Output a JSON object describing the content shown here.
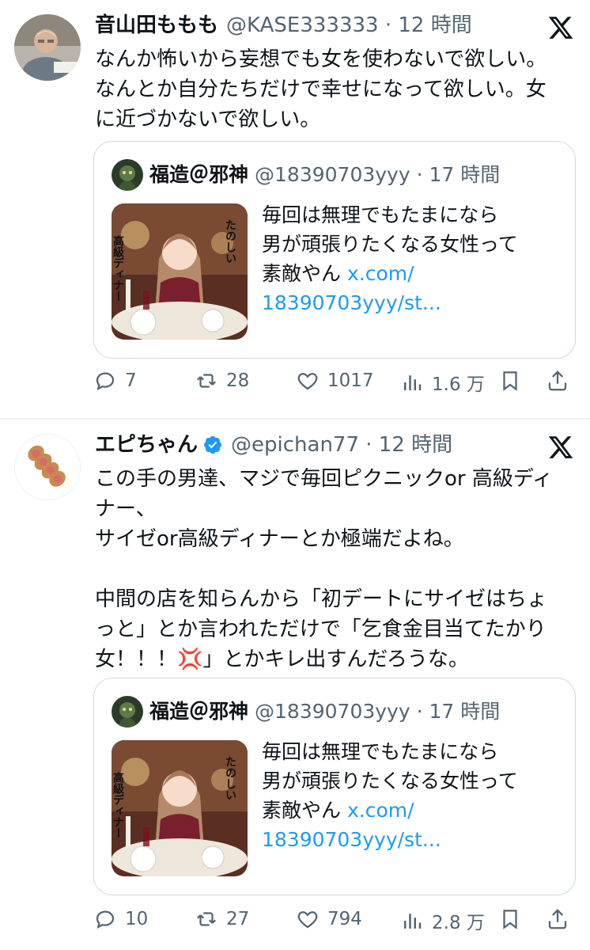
{
  "tweets": [
    {
      "name": "音山田ももも",
      "handle": "@KASE333333 · 12 時間",
      "verified": false,
      "body": "なんか怖いから妄想でも女を使わないで欲しい。\nなんとか自分たちだけで幸せになって欲しい。女\nに近づかないで欲しい。",
      "quote": {
        "name": "福造＠邪神",
        "handle": "@18390703yyy · 17 時間",
        "text": "毎回は無理でもたまになら\n男が頑張りたくなる女性って\n素敵やん ",
        "link": "x.com/\n18390703yyy/st...",
        "image_caption_1": "高級ディナー",
        "image_caption_2": "たのしい"
      },
      "stats": {
        "replies": "7",
        "reposts": "28",
        "likes": "1017",
        "views": "1.6 万"
      }
    },
    {
      "name": "エピちゃん",
      "handle": "@epichan77 · 12 時間",
      "verified": true,
      "body": "この手の男達、マジで毎回ピクニックor 高級ディ\nナー、\nサイゼor高級ディナーとか極端だよね。\n\n中間の店を知らんから「初デートにサイゼはちょ\nっと」とか言われただけで「乞食金目当てたかり\n女！！！💢」とかキレ出すんだろうな。",
      "quote": {
        "name": "福造＠邪神",
        "handle": "@18390703yyy · 17 時間",
        "text": "毎回は無理でもたまになら\n男が頑張りたくなる女性って\n素敵やん ",
        "link": "x.com/\n18390703yyy/st...",
        "image_caption_1": "高級ディナー",
        "image_caption_2": "たのしい"
      },
      "stats": {
        "replies": "10",
        "reposts": "27",
        "likes": "794",
        "views": "2.8 万"
      }
    }
  ],
  "colors": {
    "text": "#0f1419",
    "secondary": "#536471",
    "link": "#1d9bf0",
    "border": "#cfd9de",
    "verified": "#1d9bf0"
  }
}
